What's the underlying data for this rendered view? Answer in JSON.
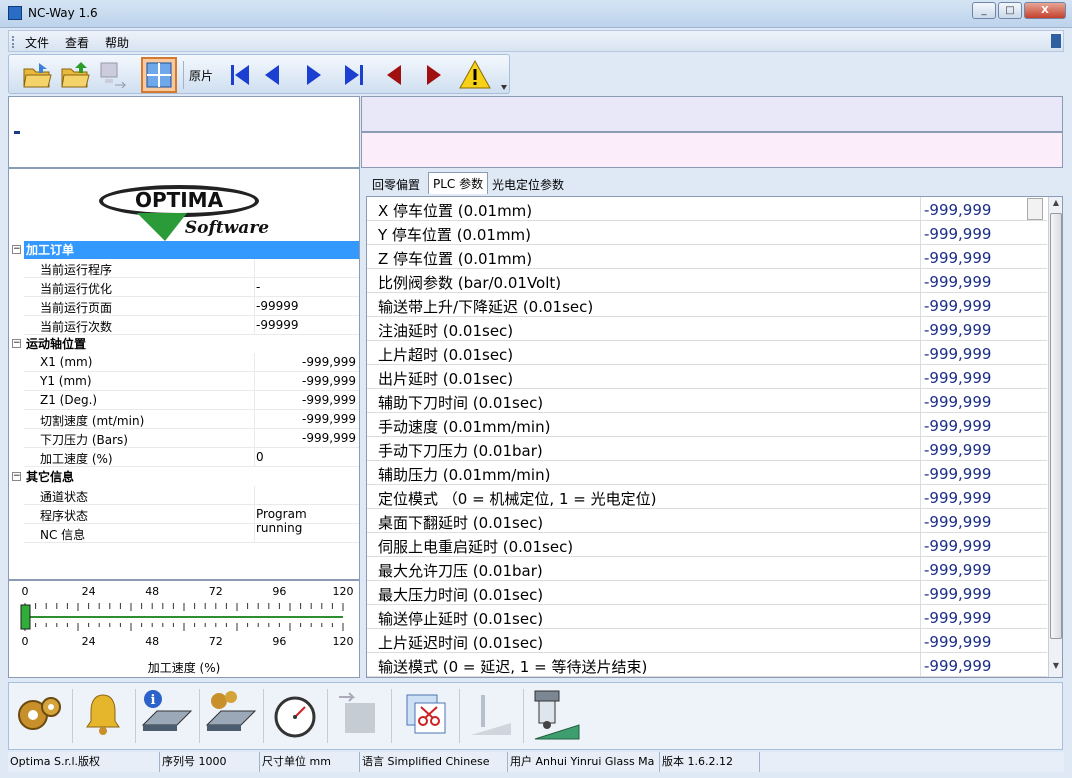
{
  "window": {
    "title": "NC-Way 1.6"
  },
  "menu": {
    "items": [
      "文件",
      "查看",
      "帮助"
    ]
  },
  "toolbar": {
    "label_original": "原片"
  },
  "order_section": {
    "title": "加工订单",
    "rows": [
      {
        "key": "当前运行程序",
        "value": ""
      },
      {
        "key": "当前运行优化",
        "value": "-"
      },
      {
        "key": "当前运行页面",
        "value": "-99999"
      },
      {
        "key": "当前运行次数",
        "value": "-99999"
      }
    ]
  },
  "axis_section": {
    "title": "运动轴位置",
    "rows": [
      {
        "key": "X1 (mm)",
        "value": "-999,999"
      },
      {
        "key": "Y1 (mm)",
        "value": "-999,999"
      },
      {
        "key": "Z1 (Deg.)",
        "value": "-999,999"
      },
      {
        "key": "切割速度 (mt/min)",
        "value": "-999,999"
      },
      {
        "key": "下刀压力 (Bars)",
        "value": "-999,999"
      },
      {
        "key": "加工速度 (%)",
        "value": "0"
      }
    ]
  },
  "other_section": {
    "title": "其它信息",
    "rows": [
      {
        "key": "通道状态",
        "value": ""
      },
      {
        "key": "程序状态",
        "value": "Program running"
      },
      {
        "key": "NC 信息",
        "value": ""
      }
    ]
  },
  "gauge": {
    "title": "加工速度 (%)",
    "ticks": [
      "0",
      "24",
      "48",
      "72",
      "96",
      "120"
    ],
    "value_percent": 0
  },
  "tabs": [
    {
      "label": "回零偏置",
      "active": false
    },
    {
      "label": "PLC 参数",
      "active": true
    },
    {
      "label": "光电定位参数",
      "active": false
    }
  ],
  "plc_params": [
    {
      "key": "X 停车位置 (0.01mm)",
      "value": "-999,999"
    },
    {
      "key": "Y 停车位置 (0.01mm)",
      "value": "-999,999"
    },
    {
      "key": "Z 停车位置 (0.01mm)",
      "value": "-999,999"
    },
    {
      "key": "比例阀参数 (bar/0.01Volt)",
      "value": "-999,999"
    },
    {
      "key": "输送带上升/下降延迟 (0.01sec)",
      "value": "-999,999"
    },
    {
      "key": "注油延时 (0.01sec)",
      "value": "-999,999"
    },
    {
      "key": "上片超时 (0.01sec)",
      "value": "-999,999"
    },
    {
      "key": "出片延时 (0.01sec)",
      "value": "-999,999"
    },
    {
      "key": "辅助下刀时间 (0.01sec)",
      "value": "-999,999"
    },
    {
      "key": "手动速度 (0.01mm/min)",
      "value": "-999,999"
    },
    {
      "key": "手动下刀压力 (0.01bar)",
      "value": "-999,999"
    },
    {
      "key": "辅助压力 (0.01mm/min)",
      "value": "-999,999"
    },
    {
      "key": "定位模式 （0 = 机械定位, 1 = 光电定位)",
      "value": "-999,999"
    },
    {
      "key": "桌面下翻延时 (0.01sec)",
      "value": "-999,999"
    },
    {
      "key": "伺服上电重启延时 (0.01sec)",
      "value": "-999,999"
    },
    {
      "key": "最大允许刀压 (0.01bar)",
      "value": "-999,999"
    },
    {
      "key": "最大压力时间 (0.01sec)",
      "value": "-999,999"
    },
    {
      "key": "输送停止延时 (0.01sec)",
      "value": "-999,999"
    },
    {
      "key": "上片延迟时间 (0.01sec)",
      "value": "-999,999"
    },
    {
      "key": "输送模式 (0 = 延迟, 1 = 等待送片结束)",
      "value": "-999,999"
    }
  ],
  "status": {
    "copyright": "Optima S.r.l.版权",
    "serial": "序列号 1000",
    "unit": "尺寸单位 mm",
    "language": "语言 Simplified Chinese",
    "user": "用户 Anhui Yinrui Glass Ma",
    "version": "版本 1.6.2.12"
  },
  "colors": {
    "accent": "#3399ff",
    "value_blue": "#1b2e86"
  }
}
